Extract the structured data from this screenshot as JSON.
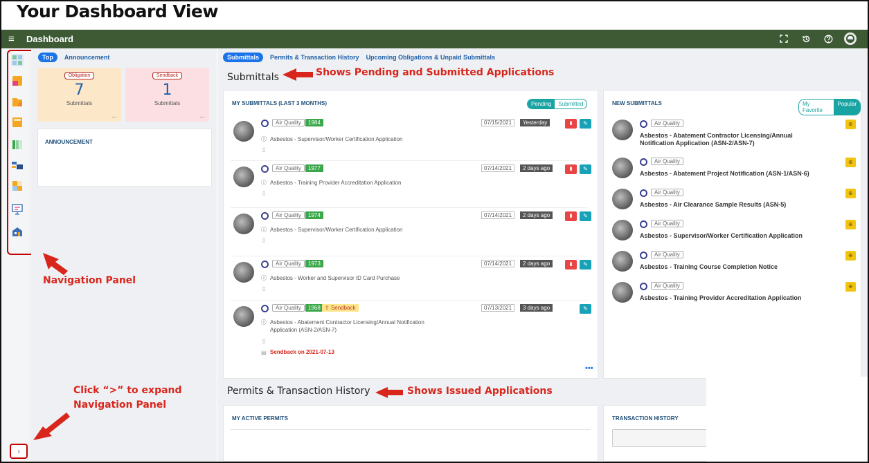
{
  "page_heading": "Your Dashboard View",
  "topbar": {
    "menu_icon": "≡",
    "title": "Dashboard",
    "icons": [
      "fullscreen-icon",
      "history-icon",
      "help-icon",
      "user-avatar-icon"
    ]
  },
  "left_tabs": {
    "top": "Top",
    "announcement": "Announcement"
  },
  "cards": {
    "obligation": {
      "tag": "Obligation",
      "count": "7",
      "label": "Submittals",
      "more": "..."
    },
    "sendback": {
      "tag": "Sendback",
      "count": "1",
      "label": "Submittals",
      "more": "..."
    }
  },
  "announcement_label": "ANNOUNCEMENT",
  "main_tabs": {
    "submittals": "Submittals",
    "permits": "Permits & Transaction History",
    "obligations": "Upcoming Obligations & Unpaid Submittals"
  },
  "sections": {
    "submittals_title": "Submittals",
    "permits_title": "Permits & Transaction History"
  },
  "my_submittals": {
    "title": "MY SUBMITTALS (LAST 3 MONTHS)",
    "toggle_pending": "Pending",
    "toggle_submitted": "Submitted",
    "rows": [
      {
        "category": "Air Quality",
        "id": "1984",
        "date": "07/15/2021",
        "ago": "Yesterday",
        "desc": "Asbestos - Supervisor/Worker Certification Application"
      },
      {
        "category": "Air Quality",
        "id": "1977",
        "date": "07/14/2021",
        "ago": "2 days ago",
        "desc": "Asbestos - Training Provider Accreditation Application"
      },
      {
        "category": "Air Quality",
        "id": "1974",
        "date": "07/14/2021",
        "ago": "2 days ago",
        "desc": "Asbestos - Supervisor/Worker Certification Application"
      },
      {
        "category": "Air Quality",
        "id": "1973",
        "date": "07/14/2021",
        "ago": "2 days ago",
        "desc": "Asbestos - Worker and Supervisor ID Card Purchase"
      },
      {
        "category": "Air Quality",
        "id": "1968",
        "sendback": "Sendback",
        "date": "07/13/2021",
        "ago": "3 days ago",
        "desc_line1": "Asbestos - Abatement Contractor Licensing/Annual Notification",
        "desc_line2": "Application (ASN-2/ASN-7)",
        "note": "Sendback on 2021-07-13"
      }
    ],
    "more": "•••"
  },
  "new_submittals": {
    "title": "NEW SUBMITTALS",
    "toggle_favorite": "My Favorite",
    "toggle_popular": "Popular",
    "rows": [
      {
        "category": "Air Quality",
        "line1": "Asbestos - Abatement Contractor Licensing/Annual",
        "line2": "Notification Application (ASN-2/ASN-7)"
      },
      {
        "category": "Air Quality",
        "line1": "Asbestos - Abatement Project Notification (ASN-1/ASN-6)",
        "line2": ""
      },
      {
        "category": "Air Quality",
        "line1": "Asbestos - Air Clearance Sample Results (ASN-5)",
        "line2": ""
      },
      {
        "category": "Air Quality",
        "line1": "Asbestos - Supervisor/Worker Certification Application",
        "line2": ""
      },
      {
        "category": "Air Quality",
        "line1": "Asbestos - Training Course Completion Notice",
        "line2": ""
      },
      {
        "category": "Air Quality",
        "line1": "Asbestos - Training Provider Accreditation Application",
        "line2": ""
      }
    ]
  },
  "permits": {
    "active_title": "MY ACTIVE PERMITS",
    "history_title": "TRANSACTION HISTORY"
  },
  "annotations": {
    "submittals_note": "Shows Pending and Submitted Applications",
    "permits_note": "Shows Issued Applications",
    "nav_panel": "Navigation Panel",
    "expand_line1": "Click “>” to expand",
    "expand_line2": "Navigation Panel"
  },
  "expand_button": "›",
  "colors": {
    "topbar": "#3d5a35",
    "accent": "#1a73e8",
    "annotation": "#d9261c",
    "teal": "#17a2b8"
  }
}
